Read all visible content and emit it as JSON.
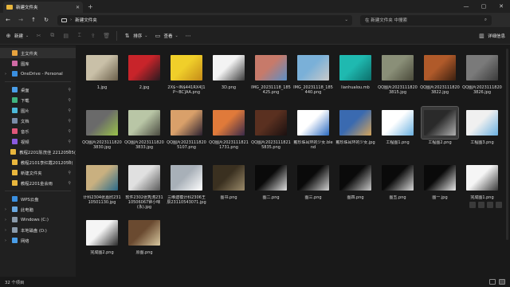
{
  "window": {
    "tab_title": "新建文件夹",
    "new_tab": "+",
    "controls": [
      "—",
      "▢",
      "✕"
    ]
  },
  "address": {
    "path": "新建文件夹",
    "search_placeholder": "在 新建文件夹 中搜索"
  },
  "toolbar": {
    "new_label": "新建",
    "sort_label": "排序",
    "view_label": "查看",
    "details_label": "详细信息"
  },
  "sidebar": {
    "items": [
      {
        "label": "主文件夹",
        "color": "#e7a33e",
        "chev": false,
        "pin": false
      },
      {
        "label": "图库",
        "color": "#d06aa5",
        "chev": false,
        "pin": false
      },
      {
        "label": "OneDrive - Personal",
        "color": "#3a8fe0",
        "chev": true,
        "pin": false
      },
      {
        "label": "桌面",
        "color": "#4a9ee8",
        "chev": false,
        "pin": true
      },
      {
        "label": "下载",
        "color": "#3fb37f",
        "chev": false,
        "pin": true
      },
      {
        "label": "图片",
        "color": "#4bb8d9",
        "chev": false,
        "pin": true
      },
      {
        "label": "文档",
        "color": "#7a8ca8",
        "chev": false,
        "pin": true
      },
      {
        "label": "音乐",
        "color": "#e0567a",
        "chev": false,
        "pin": true
      },
      {
        "label": "视频",
        "color": "#8a5ae0",
        "chev": false,
        "pin": true
      },
      {
        "label": "教程2201陈茂佳 22120505(",
        "color": "#e8b63d",
        "chev": false,
        "pin": true
      },
      {
        "label": "教程2101李红霞2012050(",
        "color": "#e8b63d",
        "chev": false,
        "pin": true
      },
      {
        "label": "新建文件夹",
        "color": "#e8b63d",
        "chev": false,
        "pin": true
      },
      {
        "label": "教程2201金会雨",
        "color": "#e8b63d",
        "chev": false,
        "pin": true
      },
      {
        "label": "WPS云盘",
        "color": "#3a8fe0",
        "chev": false,
        "pin": false
      },
      {
        "label": "此电脑",
        "color": "#6aa8e0",
        "chev": true,
        "pin": false
      },
      {
        "label": "Windows (C:)",
        "color": "#8a9aaa",
        "chev": true,
        "pin": false
      },
      {
        "label": "本地磁盘 (D:)",
        "color": "#8a9aaa",
        "chev": true,
        "pin": false
      },
      {
        "label": "网络",
        "color": "#4a9ee8",
        "chev": true,
        "pin": false
      }
    ]
  },
  "files": [
    {
      "name": "1.jpg",
      "c1": "#c9c0a8",
      "c2": "#6b5f4a"
    },
    {
      "name": "2.jpg",
      "c1": "#c8242a",
      "c2": "#2a1a20"
    },
    {
      "name": "2X$~IN$441RX4]1P~BC]AA.png",
      "c1": "#f0cf2a",
      "c2": "#c48a18"
    },
    {
      "name": "3D.png",
      "c1": "#f3f3f3",
      "c2": "#3a3a3a"
    },
    {
      "name": "IMG_20231118_185425.png",
      "c1": "#c77a6a",
      "c2": "#5b8fc7"
    },
    {
      "name": "IMG_20231118_185440.png",
      "c1": "#7ab0d8",
      "c2": "#c9c9c9"
    },
    {
      "name": "lianhualou.mb",
      "c1": "#1fb9b0",
      "c2": "#0c6e6a"
    },
    {
      "name": "QQ图片20231118203815.jpg",
      "c1": "#8a8f78",
      "c2": "#4a4a3a"
    },
    {
      "name": "QQ图片20231118203822.jpg",
      "c1": "#b05a2a",
      "c2": "#3a1f10"
    },
    {
      "name": "QQ图片20231118203826.jpg",
      "c1": "#7a7a7a",
      "c2": "#3a3a3a"
    },
    {
      "name": "QQ图片20231118203830.jpg",
      "c1": "#6a6a6a",
      "c2": "#9ac24a"
    },
    {
      "name": "QQ图片20231118203833.jpg",
      "c1": "#b9c6a6",
      "c2": "#4a4a40"
    },
    {
      "name": "QQ图片20231118205107.png",
      "c1": "#d9a06a",
      "c2": "#2a2030"
    },
    {
      "name": "QQ图片20231118211731.png",
      "c1": "#e07a3a",
      "c2": "#3a2a4a"
    },
    {
      "name": "QQ图片20231118215835.png",
      "c1": "#5a3020",
      "c2": "#1a1010"
    },
    {
      "name": "戴珍珠耳环的少女.blend",
      "c1": "#ffffff",
      "c2": "#2a6ac0"
    },
    {
      "name": "戴珍珠耳环的少女.jpg",
      "c1": "#3a6ab0",
      "c2": "#d4a45a"
    },
    {
      "name": "工程图1.png",
      "c1": "#ffffff",
      "c2": "#6ab0e0"
    },
    {
      "name": "工程图2.png",
      "c1": "#2a2a2a",
      "c2": "#b0b0b0"
    },
    {
      "name": "工程图3.png",
      "c1": "#f0f0f0",
      "c2": "#6ab0e0"
    },
    {
      "name": "计科2304张嘉欣23110501130.jpg",
      "c1": "#c9b080",
      "c2": "#2a6a8a"
    },
    {
      "name": "软件2302张秀涛23110506067钟小味(永).jpg",
      "c1": "#e0e0e0",
      "c2": "#5a5a5a"
    },
    {
      "name": "三维建模计科2306王辰23110543071.jpg",
      "c1": "#a8b0b8",
      "c2": "#ffffff"
    },
    {
      "name": "图书.png",
      "c1": "#3a3020",
      "c2": "#9a8a6a"
    },
    {
      "name": "图二.png",
      "c1": "#0a0a0a",
      "c2": "#e0e0e0"
    },
    {
      "name": "图三.png",
      "c1": "#0a0a0a",
      "c2": "#d0d0d0"
    },
    {
      "name": "图四.png",
      "c1": "#0a0a0a",
      "c2": "#c8c8c8"
    },
    {
      "name": "图五.png",
      "c1": "#0a0a0a",
      "c2": "#d8d8d8"
    },
    {
      "name": "图一.jpg",
      "c1": "#0a0a0a",
      "c2": "#e8e8e8"
    },
    {
      "name": "完成图1.png",
      "c1": "#f5f5f5",
      "c2": "#3a3a3a"
    },
    {
      "name": "完成图2.png",
      "c1": "#f5f5f5",
      "c2": "#2a2a2a"
    },
    {
      "name": "原图.png",
      "c1": "#6a4a30",
      "c2": "#d8c8a0"
    }
  ],
  "selected_file_index": 18,
  "status": {
    "count": "32 个项目"
  }
}
